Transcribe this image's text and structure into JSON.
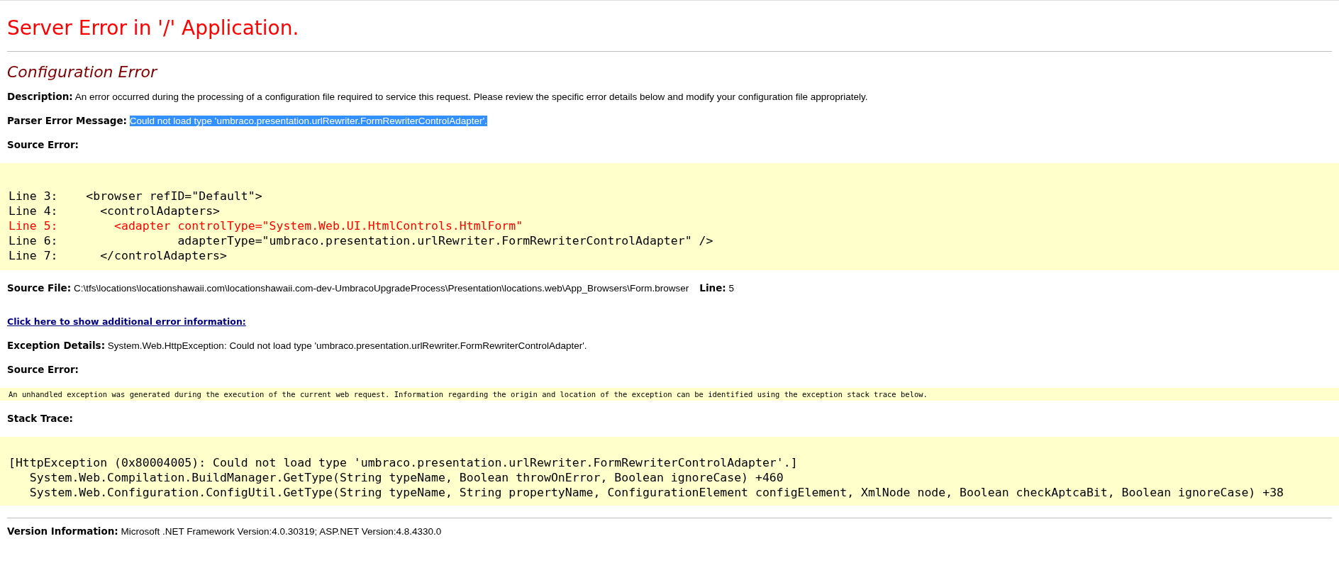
{
  "title": "Server Error in '/' Application.",
  "error_heading": "Configuration Error",
  "description": {
    "label": "Description:",
    "text": "An error occurred during the processing of a configuration file required to service this request. Please review the specific error details below and modify your configuration file appropriately."
  },
  "parser_error": {
    "label": "Parser Error Message:",
    "text": "Could not load type 'umbraco.presentation.urlRewriter.FormRewriterControlAdapter'.",
    "selected": true
  },
  "source_error_heading": "Source Error:",
  "source_code": [
    {
      "text": "Line 3:    <browser refID=\"Default\">",
      "error": false
    },
    {
      "text": "Line 4:      <controlAdapters>",
      "error": false
    },
    {
      "text": "Line 5:        <adapter controlType=\"System.Web.UI.HtmlControls.HtmlForm\"",
      "error": true
    },
    {
      "text": "Line 6:                 adapterType=\"umbraco.presentation.urlRewriter.FormRewriterControlAdapter\" />",
      "error": false
    },
    {
      "text": "Line 7:      </controlAdapters>",
      "error": false
    }
  ],
  "source_file": {
    "label": "Source File:",
    "text": "C:\\tfs\\locations\\locationshawaii.com\\locationshawaii.com-dev-UmbracoUpgradeProcess\\Presentation\\locations.web\\App_Browsers\\Form.browser",
    "line_label": "Line:",
    "line": "5"
  },
  "more_info_link": "Click here to show additional error information:",
  "exception_details": {
    "label": "Exception Details:",
    "text": "System.Web.HttpException: Could not load type 'umbraco.presentation.urlRewriter.FormRewriterControlAdapter'."
  },
  "source_error_heading_2": "Source Error:",
  "unhandled_message": "An unhandled exception was generated during the execution of the current web request. Information regarding the origin and location of the exception can be identified using the exception stack trace below.",
  "stack_trace_heading": "Stack Trace:",
  "stack_trace": [
    "[HttpException (0x80004005): Could not load type 'umbraco.presentation.urlRewriter.FormRewriterControlAdapter'.]",
    "   System.Web.Compilation.BuildManager.GetType(String typeName, Boolean throwOnError, Boolean ignoreCase) +460",
    "   System.Web.Configuration.ConfigUtil.GetType(String typeName, String propertyName, ConfigurationElement configElement, XmlNode node, Boolean checkAptcaBit, Boolean ignoreCase) +38"
  ],
  "version": {
    "label": "Version Information:",
    "text": "Microsoft .NET Framework Version:4.0.30319; ASP.NET Version:4.8.4330.0"
  }
}
